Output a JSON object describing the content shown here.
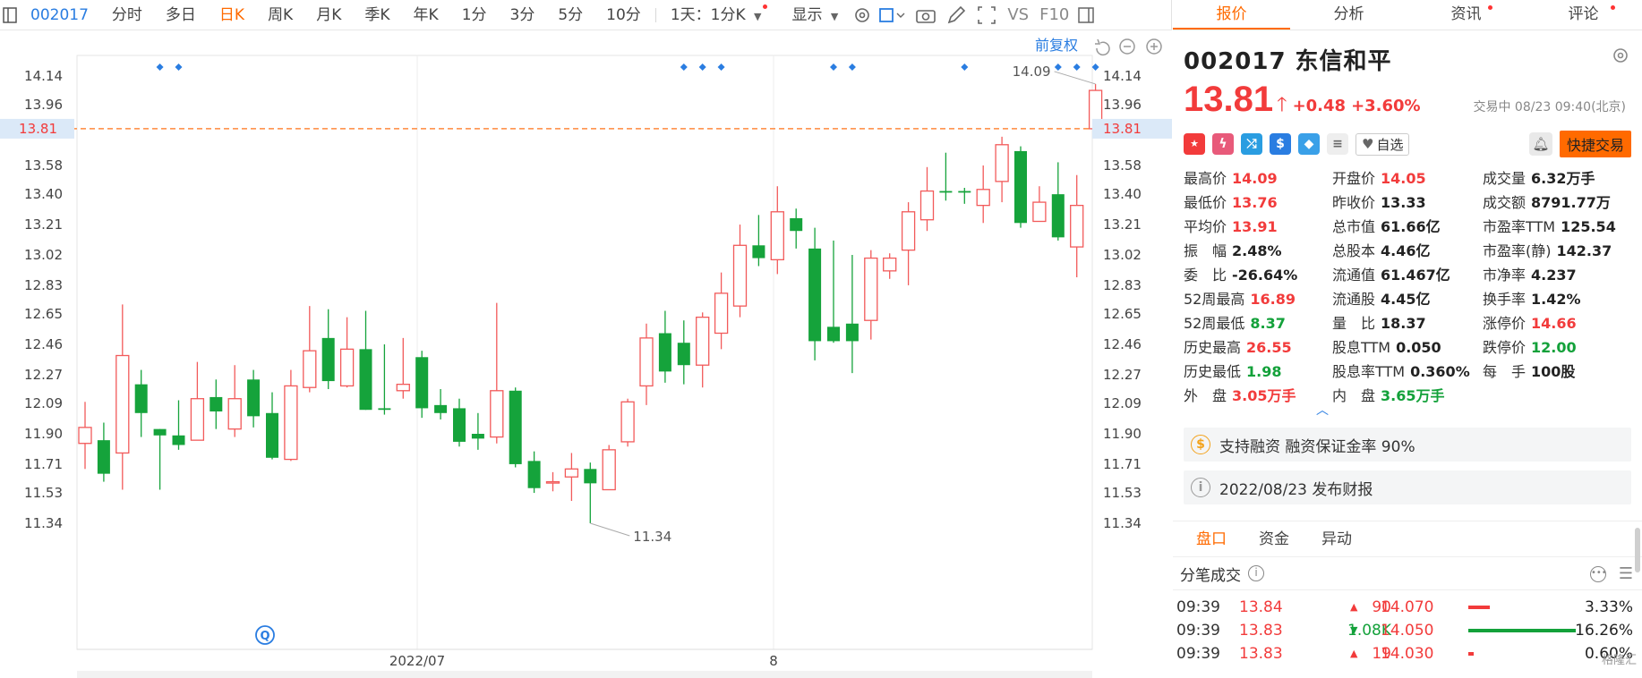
{
  "toolbar": {
    "code": "002017",
    "items": [
      "分时",
      "多日",
      "日K",
      "周K",
      "月K",
      "季K",
      "年K",
      "1分",
      "3分",
      "5分",
      "10分"
    ],
    "active_index": 2,
    "period_select": "1天：1分K",
    "display_label": "显示",
    "vs_label": "VS",
    "f10_label": "F10"
  },
  "chart": {
    "restore_label": "前复权",
    "price_marker": "13.81",
    "high_annot": "14.09",
    "low_annot": "11.34",
    "axis_labels": [
      "14.14",
      "13.96",
      "13.81",
      "13.58",
      "13.40",
      "13.21",
      "13.02",
      "12.83",
      "12.65",
      "12.46",
      "12.27",
      "12.09",
      "11.90",
      "11.71",
      "11.53",
      "11.34"
    ],
    "date_labels": [
      "2022/07",
      "8"
    ],
    "q_badge": "Q"
  },
  "chart_data": {
    "type": "candlestick",
    "ylim": [
      11.34,
      14.14
    ],
    "current_price": 13.81,
    "candles": [
      {
        "o": 11.84,
        "c": 11.94,
        "h": 12.1,
        "l": 11.68
      },
      {
        "o": 11.86,
        "c": 11.65,
        "h": 11.97,
        "l": 11.6
      },
      {
        "o": 11.78,
        "c": 12.39,
        "h": 12.71,
        "l": 11.55
      },
      {
        "o": 12.21,
        "c": 12.03,
        "h": 12.3,
        "l": 11.88
      },
      {
        "o": 11.93,
        "c": 11.89,
        "h": 11.93,
        "l": 11.55
      },
      {
        "o": 11.89,
        "c": 11.83,
        "h": 12.11,
        "l": 11.8
      },
      {
        "o": 11.86,
        "c": 12.12,
        "h": 12.35,
        "l": 11.86
      },
      {
        "o": 12.13,
        "c": 12.04,
        "h": 12.24,
        "l": 11.93
      },
      {
        "o": 11.93,
        "c": 12.12,
        "h": 12.33,
        "l": 11.88
      },
      {
        "o": 12.24,
        "c": 12.01,
        "h": 12.3,
        "l": 11.94
      },
      {
        "o": 12.03,
        "c": 11.75,
        "h": 12.16,
        "l": 11.74
      },
      {
        "o": 11.74,
        "c": 12.2,
        "h": 12.3,
        "l": 11.73
      },
      {
        "o": 12.19,
        "c": 12.42,
        "h": 12.7,
        "l": 12.16
      },
      {
        "o": 12.5,
        "c": 12.23,
        "h": 12.68,
        "l": 12.18
      },
      {
        "o": 12.2,
        "c": 12.43,
        "h": 12.63,
        "l": 12.19
      },
      {
        "o": 12.43,
        "c": 12.05,
        "h": 12.67,
        "l": 12.05
      },
      {
        "o": 12.06,
        "c": 12.05,
        "h": 12.46,
        "l": 12.02
      },
      {
        "o": 12.17,
        "c": 12.21,
        "h": 12.5,
        "l": 12.12
      },
      {
        "o": 12.38,
        "c": 12.06,
        "h": 12.42,
        "l": 12.0
      },
      {
        "o": 12.08,
        "c": 12.03,
        "h": 12.18,
        "l": 11.99
      },
      {
        "o": 12.06,
        "c": 11.85,
        "h": 12.12,
        "l": 11.82
      },
      {
        "o": 11.9,
        "c": 11.87,
        "h": 12.03,
        "l": 11.8
      },
      {
        "o": 11.88,
        "c": 12.17,
        "h": 12.72,
        "l": 11.84
      },
      {
        "o": 12.17,
        "c": 11.71,
        "h": 12.19,
        "l": 11.69
      },
      {
        "o": 11.73,
        "c": 11.56,
        "h": 11.79,
        "l": 11.53
      },
      {
        "o": 11.6,
        "c": 11.6,
        "h": 11.66,
        "l": 11.54
      },
      {
        "o": 11.63,
        "c": 11.68,
        "h": 11.78,
        "l": 11.48
      },
      {
        "o": 11.68,
        "c": 11.59,
        "h": 11.72,
        "l": 11.34
      },
      {
        "o": 11.55,
        "c": 11.8,
        "h": 11.83,
        "l": 11.55
      },
      {
        "o": 11.85,
        "c": 12.1,
        "h": 12.12,
        "l": 11.82
      },
      {
        "o": 12.2,
        "c": 12.5,
        "h": 12.59,
        "l": 12.08
      },
      {
        "o": 12.53,
        "c": 12.29,
        "h": 12.67,
        "l": 12.22
      },
      {
        "o": 12.47,
        "c": 12.33,
        "h": 12.61,
        "l": 12.21
      },
      {
        "o": 12.33,
        "c": 12.63,
        "h": 12.66,
        "l": 12.19
      },
      {
        "o": 12.53,
        "c": 12.78,
        "h": 12.91,
        "l": 12.43
      },
      {
        "o": 12.7,
        "c": 13.08,
        "h": 13.21,
        "l": 12.63
      },
      {
        "o": 13.08,
        "c": 13.0,
        "h": 13.27,
        "l": 12.95
      },
      {
        "o": 12.99,
        "c": 13.29,
        "h": 13.45,
        "l": 12.9
      },
      {
        "o": 13.25,
        "c": 13.17,
        "h": 13.31,
        "l": 13.06
      },
      {
        "o": 13.06,
        "c": 12.48,
        "h": 13.19,
        "l": 12.36
      },
      {
        "o": 12.57,
        "c": 12.48,
        "h": 13.11,
        "l": 12.47
      },
      {
        "o": 12.59,
        "c": 12.48,
        "h": 13.02,
        "l": 12.28
      },
      {
        "o": 12.61,
        "c": 13.0,
        "h": 13.05,
        "l": 12.49
      },
      {
        "o": 12.92,
        "c": 13.0,
        "h": 13.03,
        "l": 12.87
      },
      {
        "o": 13.05,
        "c": 13.29,
        "h": 13.35,
        "l": 12.83
      },
      {
        "o": 13.24,
        "c": 13.42,
        "h": 13.57,
        "l": 13.17
      },
      {
        "o": 13.42,
        "c": 13.41,
        "h": 13.66,
        "l": 13.36
      },
      {
        "o": 13.42,
        "c": 13.41,
        "h": 13.44,
        "l": 13.34
      },
      {
        "o": 13.33,
        "c": 13.43,
        "h": 13.58,
        "l": 13.22
      },
      {
        "o": 13.48,
        "c": 13.71,
        "h": 13.76,
        "l": 13.35
      },
      {
        "o": 13.67,
        "c": 13.22,
        "h": 13.7,
        "l": 13.19
      },
      {
        "o": 13.23,
        "c": 13.35,
        "h": 13.45,
        "l": 13.23
      },
      {
        "o": 13.4,
        "c": 13.13,
        "h": 13.6,
        "l": 13.11
      },
      {
        "o": 13.07,
        "c": 13.33,
        "h": 13.52,
        "l": 12.88
      },
      {
        "o": 13.81,
        "c": 14.05,
        "h": 14.09,
        "l": 13.76
      }
    ],
    "event_markers": [
      4,
      5,
      32,
      33,
      34,
      40,
      41,
      47,
      52,
      53,
      54
    ]
  },
  "header": {
    "tabs": [
      {
        "label": "报价",
        "dot": false
      },
      {
        "label": "分析",
        "dot": false
      },
      {
        "label": "资讯",
        "dot": true
      },
      {
        "label": "评论",
        "dot": true
      }
    ],
    "code": "002017",
    "name": "东信和平",
    "price": "13.81",
    "change": "+0.48",
    "pct": "+3.60%",
    "status": "交易中 08/23 09:40(北京)",
    "watch_label": "自选",
    "trade_label": "快捷交易"
  },
  "stats": [
    [
      {
        "k": "最高价",
        "v": "14.09",
        "c": "red"
      },
      {
        "k": "开盘价",
        "v": "14.05",
        "c": "red"
      },
      {
        "k": "成交量",
        "v": "6.32万手",
        "c": "blk"
      }
    ],
    [
      {
        "k": "最低价",
        "v": "13.76",
        "c": "red"
      },
      {
        "k": "昨收价",
        "v": "13.33",
        "c": "blk"
      },
      {
        "k": "成交额",
        "v": "8791.77万",
        "c": "blk"
      }
    ],
    [
      {
        "k": "平均价",
        "v": "13.91",
        "c": "red"
      },
      {
        "k": "总市值",
        "v": "61.66亿",
        "c": "blk"
      },
      {
        "k": "市盈率TTM",
        "v": "125.54",
        "c": "blk"
      }
    ],
    [
      {
        "k": "振　幅",
        "v": "2.48%",
        "c": "blk"
      },
      {
        "k": "总股本",
        "v": "4.46亿",
        "c": "blk"
      },
      {
        "k": "市盈率(静)",
        "v": "142.37",
        "c": "blk"
      }
    ],
    [
      {
        "k": "委　比",
        "v": "-26.64%",
        "c": "blk"
      },
      {
        "k": "流通值",
        "v": "61.467亿",
        "c": "blk"
      },
      {
        "k": "市净率",
        "v": "4.237",
        "c": "blk"
      }
    ],
    [
      {
        "k": "52周最高",
        "v": "16.89",
        "c": "red"
      },
      {
        "k": "流通股",
        "v": "4.45亿",
        "c": "blk"
      },
      {
        "k": "换手率",
        "v": "1.42%",
        "c": "blk"
      }
    ],
    [
      {
        "k": "52周最低",
        "v": "8.37",
        "c": "green"
      },
      {
        "k": "量　比",
        "v": "18.37",
        "c": "blk"
      },
      {
        "k": "涨停价",
        "v": "14.66",
        "c": "red"
      }
    ],
    [
      {
        "k": "历史最高",
        "v": "26.55",
        "c": "red"
      },
      {
        "k": "股息TTM",
        "v": "0.050",
        "c": "blk"
      },
      {
        "k": "跌停价",
        "v": "12.00",
        "c": "green"
      }
    ],
    [
      {
        "k": "历史最低",
        "v": "1.98",
        "c": "green"
      },
      {
        "k": "股息率TTM",
        "v": "0.360%",
        "c": "blk"
      },
      {
        "k": "每　手",
        "v": "100股",
        "c": "blk"
      }
    ],
    [
      {
        "k": "外　盘",
        "v": "3.05万手",
        "c": "red"
      },
      {
        "k": "内　盘",
        "v": "3.65万手",
        "c": "green"
      },
      {
        "k": "",
        "v": "",
        "c": "blk"
      }
    ]
  ],
  "notices": {
    "margin": "支持融资 融资保证金率 90%",
    "report": "2022/08/23  发布财报"
  },
  "lower_tabs": [
    "盘口",
    "资金",
    "异动"
  ],
  "flow": {
    "title": "分笔成交",
    "rows": [
      {
        "t": "09:39",
        "p": "13.84",
        "q": "90",
        "dir": "up",
        "bp": "14.070",
        "bar": 24,
        "bc": "red",
        "pc": "3.33%"
      },
      {
        "t": "09:39",
        "p": "13.83",
        "q": "1.08K",
        "dir": "down",
        "bp": "14.050",
        "bar": 120,
        "bc": "green",
        "pc": "16.26%"
      },
      {
        "t": "09:39",
        "p": "13.83",
        "q": "19",
        "dir": "up",
        "bp": "14.030",
        "bar": 6,
        "bc": "red",
        "pc": "0.60%"
      }
    ]
  },
  "watermark": "格隆汇"
}
